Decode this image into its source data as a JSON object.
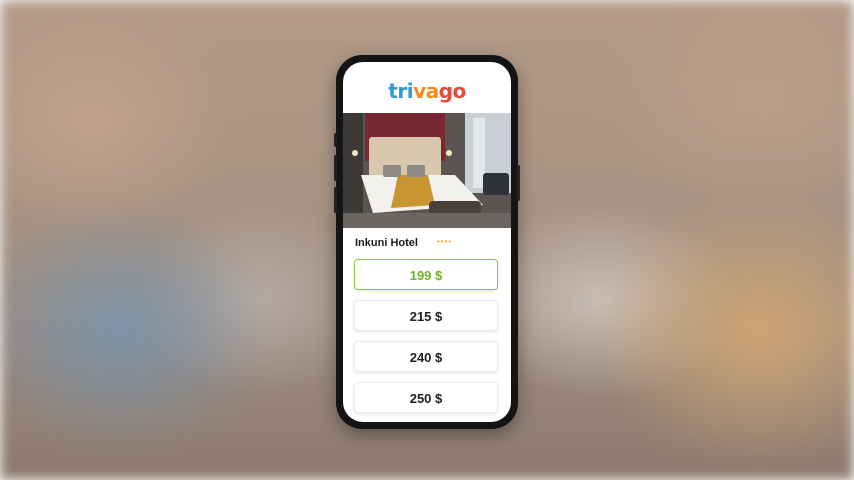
{
  "brand": {
    "logo_text": [
      "tri",
      "va",
      "go"
    ],
    "colors": [
      "#2d9ad5",
      "#f28b1e",
      "#e24c3a"
    ]
  },
  "hotel": {
    "name": "Inkuni Hotel",
    "stars_text": "••••",
    "star_rating": 4,
    "photo": "hotel-bedroom-photo"
  },
  "prices": [
    {
      "label": "199 $",
      "highlighted": true
    },
    {
      "label": "215 $",
      "highlighted": false
    },
    {
      "label": "240 $",
      "highlighted": false
    },
    {
      "label": "250 $",
      "highlighted": false
    }
  ],
  "accent_color": "#8ec63f",
  "star_color": "#f2a21a"
}
